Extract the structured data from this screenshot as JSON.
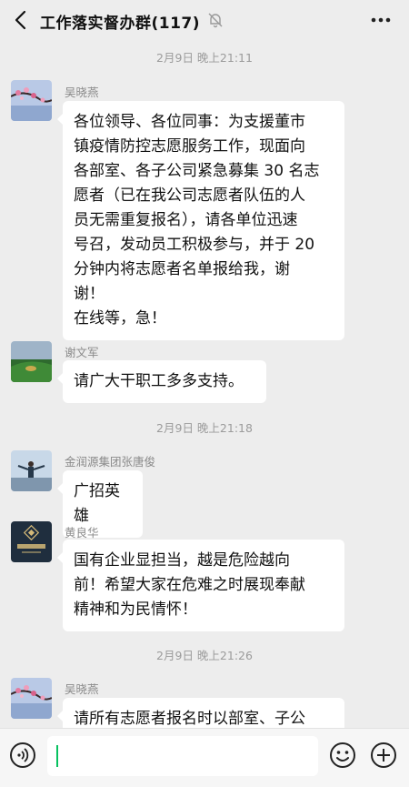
{
  "header": {
    "title": "工作落实督办群(117)"
  },
  "messages": [
    {
      "type": "timestamp",
      "text": "2月9日 晚上21:11"
    },
    {
      "type": "message",
      "sender": "吴晓燕",
      "text": "各位领导、各位同事：为支援董市\n镇疫情防控志愿服务工作，现面向\n各部室、各子公司紧急募集 30 名志\n愿者（已在我公司志愿者队伍的人\n员无需重复报名），请各单位迅速\n号召，发动员工积极参与，并于 20\n分钟内将志愿者名单报给我，谢\n谢！\n在线等，急！"
    },
    {
      "type": "message",
      "sender": "谢文军",
      "text": "请广大干职工多多支持。"
    },
    {
      "type": "timestamp",
      "text": "2月9日 晚上21:18"
    },
    {
      "type": "message",
      "sender": "金润源集团张唐俊",
      "text": "广招英雄"
    },
    {
      "type": "message",
      "sender": "黄良华",
      "text": "国有企业显担当，越是危险越向\n前！希望大家在危难之时展现奉献\n精神和为民情怀！"
    },
    {
      "type": "timestamp",
      "text": "2月9日 晚上21:26"
    },
    {
      "type": "message",
      "sender": "吴晓燕",
      "text": "请所有志愿者报名时以部室、子公"
    }
  ],
  "input": {
    "value": "",
    "placeholder": ""
  },
  "colors": {
    "background": "#ededed",
    "bubble": "#ffffff",
    "accent": "#07c160"
  },
  "icons": {
    "back": "chevron-left-icon",
    "mute": "bell-muted-icon",
    "more": "more-dots-icon",
    "voice": "voice-icon",
    "emoji": "emoji-icon",
    "plus": "plus-icon"
  }
}
